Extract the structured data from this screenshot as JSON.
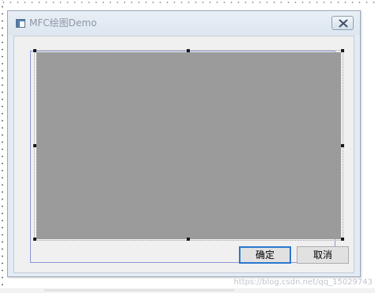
{
  "window": {
    "title": "MFC绘图Demo",
    "icon": "app-window-icon",
    "close_icon": "close-x-icon"
  },
  "buttons": {
    "ok_label": "确定",
    "cancel_label": "取消"
  },
  "picture": {
    "fill_color": "#9b9b9b"
  },
  "colors": {
    "title_bar": "#e3ebf4",
    "client": "#f0f0f0",
    "guide": "#8d97d6",
    "default_button_border": "#2a78d0"
  },
  "watermark": "https://blog.csdn.net/qq_15029743"
}
